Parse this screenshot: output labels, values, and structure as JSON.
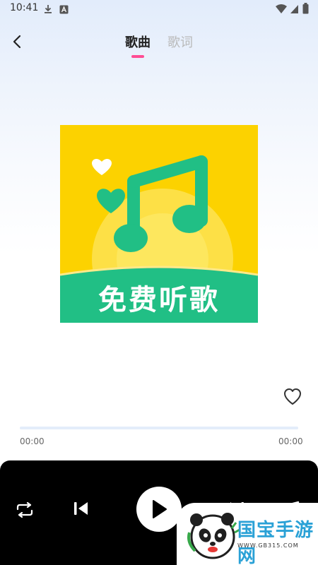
{
  "status_bar": {
    "time": "10:41",
    "icons": [
      "download-icon",
      "a-notification-icon",
      "wifi-icon",
      "signal-icon",
      "battery-icon"
    ]
  },
  "header": {
    "back_icon": "chevron-left-icon",
    "tabs": [
      {
        "label": "歌曲",
        "active": true
      },
      {
        "label": "歌词",
        "active": false
      }
    ],
    "indicator_color": "#ff4d94"
  },
  "cover": {
    "banner_text": "免费听歌",
    "background_color": "#fcd200",
    "accent_color": "#21bf85",
    "icon": "music-note-with-hearts-icon"
  },
  "favorite": {
    "icon": "heart-outline-icon"
  },
  "progress": {
    "current_time": "00:00",
    "total_time": "00:00",
    "fraction": 0
  },
  "controls": {
    "icons": [
      "repeat-icon",
      "previous-icon",
      "play-icon",
      "next-icon",
      "playlist-icon"
    ]
  },
  "watermark": {
    "brand": "国宝手游网",
    "url": "WWW.GB315.COM"
  }
}
